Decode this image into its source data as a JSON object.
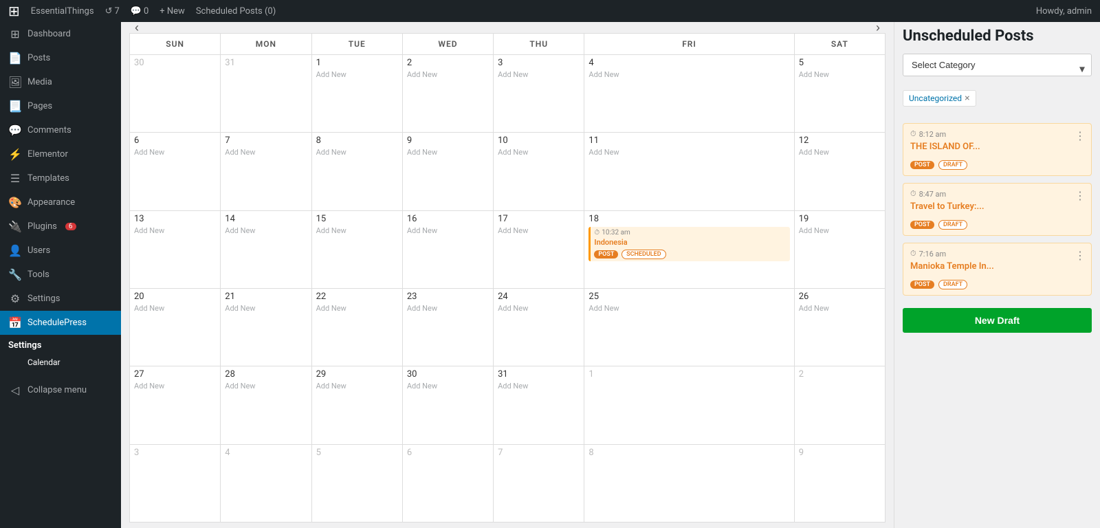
{
  "topbar": {
    "wp_logo": "⊞",
    "site_name": "EssentialThings",
    "updates_count": "7",
    "comments_count": "0",
    "new_label": "+ New",
    "scheduled_label": "Scheduled Posts (0)",
    "howdy": "Howdy, admin"
  },
  "sidebar": {
    "items": [
      {
        "id": "dashboard",
        "icon": "⊞",
        "label": "Dashboard"
      },
      {
        "id": "posts",
        "icon": "📄",
        "label": "Posts"
      },
      {
        "id": "media",
        "icon": "🖼",
        "label": "Media"
      },
      {
        "id": "pages",
        "icon": "📃",
        "label": "Pages"
      },
      {
        "id": "comments",
        "icon": "💬",
        "label": "Comments"
      },
      {
        "id": "elementor",
        "icon": "⚡",
        "label": "Elementor"
      },
      {
        "id": "templates",
        "icon": "☰",
        "label": "Templates"
      },
      {
        "id": "appearance",
        "icon": "🎨",
        "label": "Appearance"
      },
      {
        "id": "plugins",
        "icon": "🔌",
        "label": "Plugins",
        "badge": "6"
      },
      {
        "id": "users",
        "icon": "👤",
        "label": "Users"
      },
      {
        "id": "tools",
        "icon": "🔧",
        "label": "Tools"
      },
      {
        "id": "settings",
        "icon": "⚙",
        "label": "Settings"
      },
      {
        "id": "schedulepress",
        "icon": "📅",
        "label": "SchedulePress",
        "active": true
      }
    ],
    "settings_heading": "Settings",
    "sub_items": [
      {
        "id": "calendar",
        "label": "Calendar",
        "active": true
      }
    ],
    "collapse_label": "Collapse menu"
  },
  "calendar": {
    "days": [
      "SUN",
      "MON",
      "TUE",
      "WED",
      "THU",
      "FRI",
      "SAT"
    ],
    "add_new_label": "Add New",
    "event": {
      "time": "10:32 am",
      "title": "Indonesia",
      "tag1": "POST",
      "tag2": "SCHEDULED",
      "day": 18
    },
    "weeks": [
      [
        {
          "num": "30",
          "other": true
        },
        {
          "num": "31",
          "other": true
        },
        {
          "num": "1"
        },
        {
          "num": "2"
        },
        {
          "num": "3"
        },
        {
          "num": "4"
        },
        {
          "num": "5"
        }
      ],
      [
        {
          "num": "6"
        },
        {
          "num": "7"
        },
        {
          "num": "8"
        },
        {
          "num": "9"
        },
        {
          "num": "10"
        },
        {
          "num": "11"
        },
        {
          "num": "12"
        }
      ],
      [
        {
          "num": "13"
        },
        {
          "num": "14"
        },
        {
          "num": "15"
        },
        {
          "num": "16"
        },
        {
          "num": "17"
        },
        {
          "num": "18",
          "has_event": true
        },
        {
          "num": "19"
        }
      ],
      [
        {
          "num": "20"
        },
        {
          "num": "21"
        },
        {
          "num": "22"
        },
        {
          "num": "23"
        },
        {
          "num": "24"
        },
        {
          "num": "25"
        },
        {
          "num": "26"
        }
      ],
      [
        {
          "num": "27"
        },
        {
          "num": "28"
        },
        {
          "num": "29"
        },
        {
          "num": "30"
        },
        {
          "num": "31"
        },
        {
          "num": "1",
          "other": true
        },
        {
          "num": "2",
          "other": true
        }
      ],
      [
        {
          "num": "3",
          "other": true
        },
        {
          "num": "4",
          "other": true
        },
        {
          "num": "5",
          "other": true
        },
        {
          "num": "6",
          "other": true
        },
        {
          "num": "7",
          "other": true
        },
        {
          "num": "8",
          "other": true
        },
        {
          "num": "9",
          "other": true
        }
      ]
    ]
  },
  "right_panel": {
    "title": "Unscheduled Posts",
    "select_category_label": "Select Category",
    "category_tag": "Uncategorized",
    "cards": [
      {
        "time": "8:12 am",
        "title": "THE ISLAND OF...",
        "tag1": "POST",
        "tag2": "DRAFT"
      },
      {
        "time": "8:47 am",
        "title": "Travel to Turkey:...",
        "tag1": "POST",
        "tag2": "DRAFT"
      },
      {
        "time": "7:16 am",
        "title": "Manioka Temple In...",
        "tag1": "POST",
        "tag2": "DRAFT"
      }
    ],
    "new_draft_label": "New Draft"
  }
}
